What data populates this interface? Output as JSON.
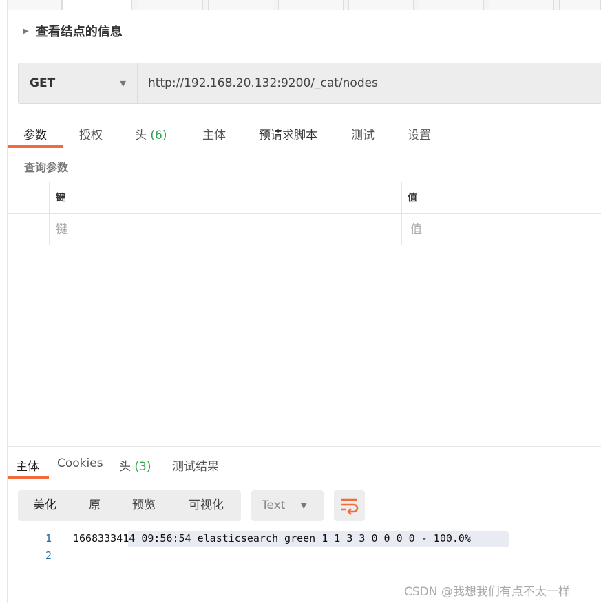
{
  "request": {
    "title": "查看结点的信息",
    "method": "GET",
    "url": "http://192.168.20.132:9200/_cat/nodes"
  },
  "req_tabs": [
    {
      "label": "参数"
    },
    {
      "label": "授权"
    },
    {
      "label": "头",
      "count": "(6)"
    },
    {
      "label": "主体"
    },
    {
      "label": "预请求脚本"
    },
    {
      "label": "测试"
    },
    {
      "label": "设置"
    }
  ],
  "params": {
    "title": "查询参数",
    "key_header": "键",
    "value_header": "值",
    "key_placeholder": "键",
    "value_placeholder": "值"
  },
  "resp_tabs": [
    {
      "label": "主体"
    },
    {
      "label": "Cookies"
    },
    {
      "label": "头",
      "count": "(3)"
    },
    {
      "label": "测试结果"
    }
  ],
  "view_modes": [
    "美化",
    "原",
    "预览",
    "可视化"
  ],
  "format": "Text",
  "icons": {
    "wrap": "wrap-lines-icon"
  },
  "body_lines": [
    {
      "n": "1",
      "text": "1668333414 09:56:54 elasticsearch green 1 1 3 3 0 0 0 0 - 100.0%"
    },
    {
      "n": "2",
      "text": ""
    }
  ],
  "watermark": "CSDN @我想我们有点不太一样",
  "colors": {
    "accent": "#f26b3a",
    "count": "#2ea44f"
  }
}
